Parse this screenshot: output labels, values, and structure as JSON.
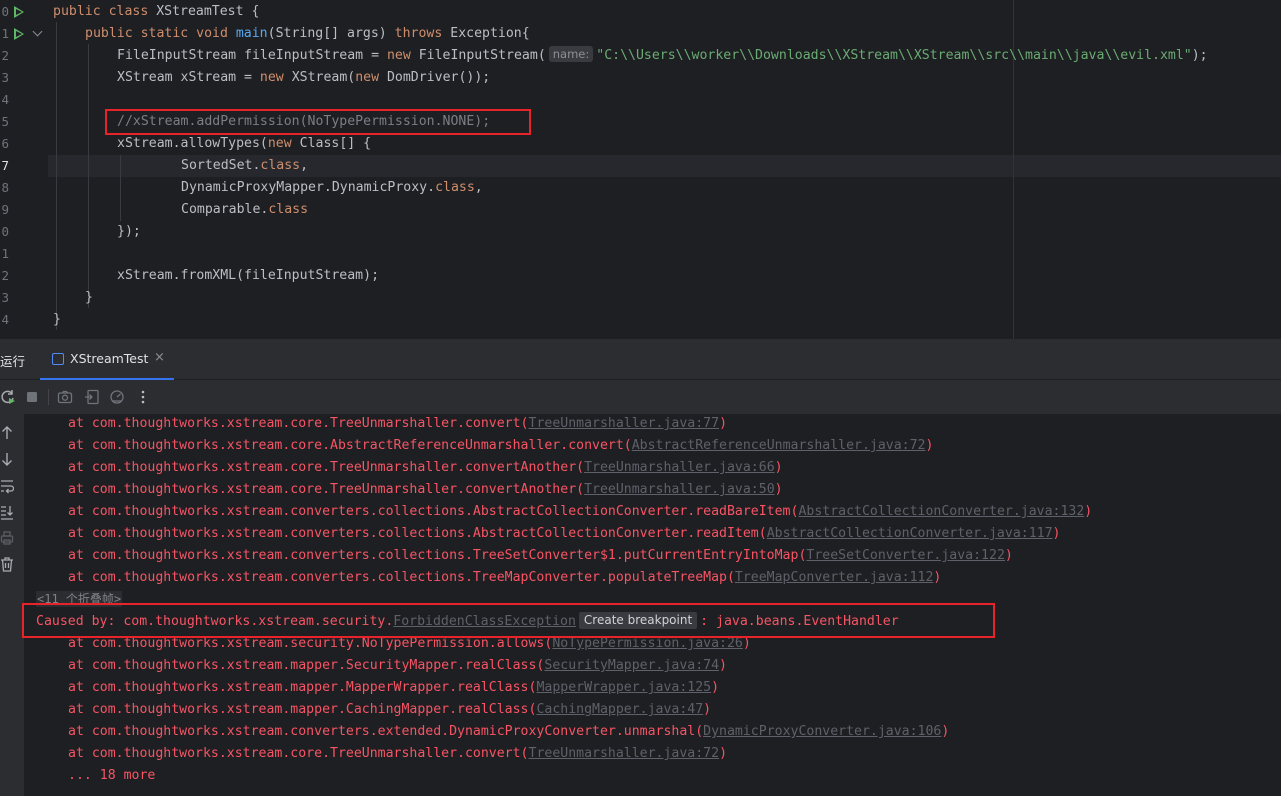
{
  "editor": {
    "line_numbers": [
      "0",
      "1",
      "2",
      "3",
      "4",
      "5",
      "6",
      "7",
      "8",
      "9",
      "0",
      "1",
      "2",
      "3",
      "4"
    ],
    "code": {
      "l0_a": "public class ",
      "l0_b": "XStreamTest {",
      "l1_a": "public static void ",
      "l1_fn": "main",
      "l1_b": "(String[] args) ",
      "l1_kw2": "throws",
      "l1_c": " Exception{",
      "l2_a": "FileInputStream fileInputStream = ",
      "l2_kw": "new",
      "l2_b": " FileInputStream(",
      "l2_hint": "name:",
      "l2_str": "\"C:\\\\Users\\\\worker\\\\Downloads\\\\XStream\\\\XStream\\\\src\\\\main\\\\java\\\\evil.xml\"",
      "l2_c": ");",
      "l3_a": "XStream xStream = ",
      "l3_kw": "new",
      "l3_b": " XStream(",
      "l3_kw2": "new",
      "l3_c": " DomDriver());",
      "l5": "//xStream.addPermission(NoTypePermission.NONE);",
      "l6_a": "xStream.allowTypes(",
      "l6_kw": "new",
      "l6_b": " Class[] {",
      "l7_a": "SortedSet.",
      "l7_kw": "class",
      "l7_b": ",",
      "l8_a": "DynamicProxyMapper.DynamicProxy.",
      "l8_kw": "class",
      "l8_b": ",",
      "l9_a": "Comparable.",
      "l9_kw": "class",
      "l10": "});",
      "l12": "xStream.fromXML(fileInputStream);",
      "l13": "}",
      "l14": "}"
    }
  },
  "run_window": {
    "title": "运行",
    "tab_label": "XStreamTest",
    "tab_close": "×"
  },
  "console": {
    "lines_top": [
      {
        "pre": "at com.thoughtworks.xstream.core.TreeUnmarshaller.convert(",
        "link": "TreeUnmarshaller.java:77",
        "post": ")"
      },
      {
        "pre": "at com.thoughtworks.xstream.core.AbstractReferenceUnmarshaller.convert(",
        "link": "AbstractReferenceUnmarshaller.java:72",
        "post": ")"
      },
      {
        "pre": "at com.thoughtworks.xstream.core.TreeUnmarshaller.convertAnother(",
        "link": "TreeUnmarshaller.java:66",
        "post": ")"
      },
      {
        "pre": "at com.thoughtworks.xstream.core.TreeUnmarshaller.convertAnother(",
        "link": "TreeUnmarshaller.java:50",
        "post": ")"
      },
      {
        "pre": "at com.thoughtworks.xstream.converters.collections.AbstractCollectionConverter.readBareItem(",
        "link": "AbstractCollectionConverter.java:132",
        "post": ")"
      },
      {
        "pre": "at com.thoughtworks.xstream.converters.collections.AbstractCollectionConverter.readItem(",
        "link": "AbstractCollectionConverter.java:117",
        "post": ")"
      },
      {
        "pre": "at com.thoughtworks.xstream.converters.collections.TreeSetConverter$1.putCurrentEntryIntoMap(",
        "link": "TreeSetConverter.java:122",
        "post": ")"
      },
      {
        "pre": "at com.thoughtworks.xstream.converters.collections.TreeMapConverter.populateTreeMap(",
        "link": "TreeMapConverter.java:112",
        "post": ")"
      }
    ],
    "folded": "<11 个折叠帧>",
    "caused_pre": "Caused by: com.thoughtworks.xstream.security.",
    "caused_link": "ForbiddenClassException",
    "caused_tooltip": "Create breakpoint",
    "caused_post": ": java.beans.EventHandler",
    "lines_bottom": [
      {
        "pre": "at com.thoughtworks.xstream.security.NoTypePermission.allows(",
        "link": "NoTypePermission.java:26",
        "post": ")"
      },
      {
        "pre": "at com.thoughtworks.xstream.mapper.SecurityMapper.realClass(",
        "link": "SecurityMapper.java:74",
        "post": ")"
      },
      {
        "pre": "at com.thoughtworks.xstream.mapper.MapperWrapper.realClass(",
        "link": "MapperWrapper.java:125",
        "post": ")"
      },
      {
        "pre": "at com.thoughtworks.xstream.mapper.CachingMapper.realClass(",
        "link": "CachingMapper.java:47",
        "post": ")"
      },
      {
        "pre": "at com.thoughtworks.xstream.converters.extended.DynamicProxyConverter.unmarshal(",
        "link": "DynamicProxyConverter.java:106",
        "post": ")"
      },
      {
        "pre": "at com.thoughtworks.xstream.core.TreeUnmarshaller.convert(",
        "link": "TreeUnmarshaller.java:72",
        "post": ")"
      }
    ],
    "more": "... 18 more"
  },
  "colors": {
    "background": "#1e1f22",
    "panel": "#2b2d30",
    "error_text": "#f75464",
    "highlight_box": "#e8232a",
    "tab_accent": "#3574f0"
  },
  "icons": {
    "toolbar": [
      "rerun-icon",
      "stop-icon",
      "camera-icon",
      "restore-layout-icon",
      "memory-icon",
      "more-options-icon"
    ],
    "leftbar": [
      "arrow-up-icon",
      "arrow-down-icon",
      "soft-wrap-icon",
      "scroll-to-end-icon",
      "print-icon",
      "trash-icon"
    ]
  }
}
